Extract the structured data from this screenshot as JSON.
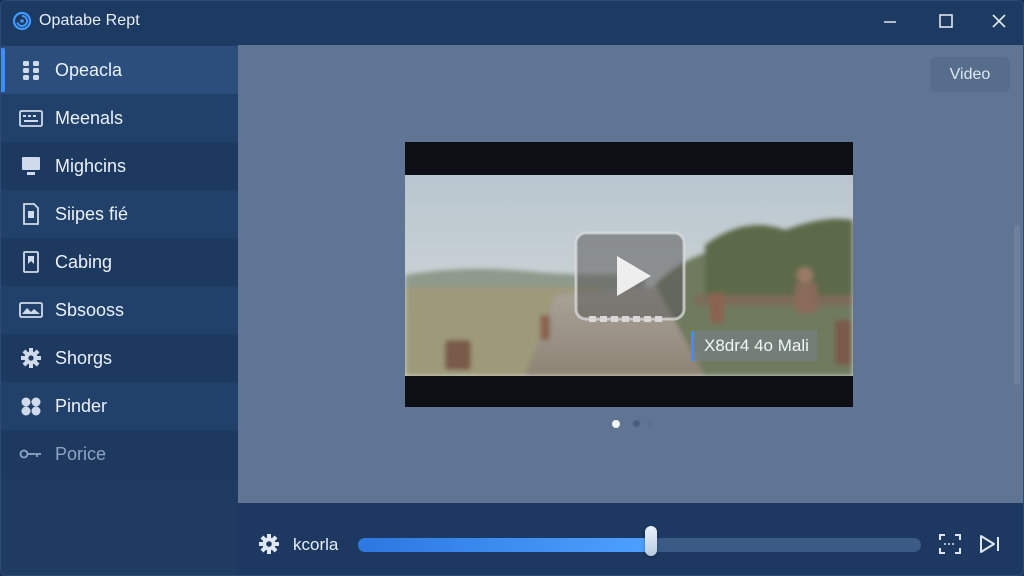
{
  "window": {
    "title": "Opatabe Rept"
  },
  "sidebar": {
    "items": [
      {
        "label": "Opeacla",
        "icon": "grid-icon",
        "active": true
      },
      {
        "label": "Meenals",
        "icon": "keyboard-icon"
      },
      {
        "label": "Mighcins",
        "icon": "monitor-icon"
      },
      {
        "label": "Siipes fié",
        "icon": "file-icon"
      },
      {
        "label": "Cabing",
        "icon": "bookmark-icon"
      },
      {
        "label": "Sbsooss",
        "icon": "image-icon"
      },
      {
        "label": "Shorgs",
        "icon": "gear-icon"
      },
      {
        "label": "Pinder",
        "icon": "fan-icon"
      },
      {
        "label": "Porice",
        "icon": "key-icon",
        "dimmed": true
      }
    ]
  },
  "main": {
    "video_button_label": "Video",
    "player": {
      "caption": "X8dr4 4o Mali",
      "pager": {
        "count": 3,
        "current": 1
      }
    }
  },
  "controls": {
    "label": "kcorla",
    "progress": 0.52
  },
  "colors": {
    "accent": "#3f8cff",
    "sidebar_bg": "#1f3b62",
    "content_bg": "#5f7593",
    "titlebar_bg": "#1d3a62"
  }
}
